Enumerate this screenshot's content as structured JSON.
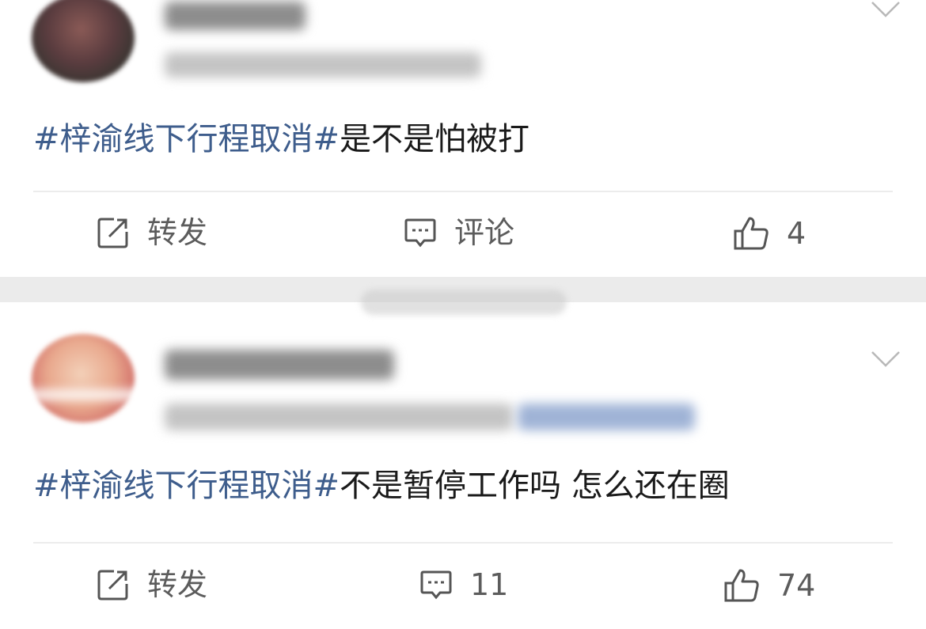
{
  "posts": [
    {
      "hashtag": "#梓渝线下行程取消#",
      "text": "是不是怕被打",
      "actions": {
        "repost_label": "转发",
        "comment_label": "评论",
        "like_count": "4"
      }
    },
    {
      "hashtag": "#梓渝线下行程取消#",
      "text": "不是暂停工作吗 怎么还在圈",
      "actions": {
        "repost_label": "转发",
        "comment_count": "11",
        "like_count": "74"
      }
    }
  ],
  "colors": {
    "hashtag": "#3e5d8c",
    "text": "#1a1a1a",
    "action": "#5c5c5c",
    "separator": "#ebebeb"
  },
  "icons": [
    "repost-icon",
    "comment-icon",
    "like-icon",
    "chevron-down-icon"
  ]
}
